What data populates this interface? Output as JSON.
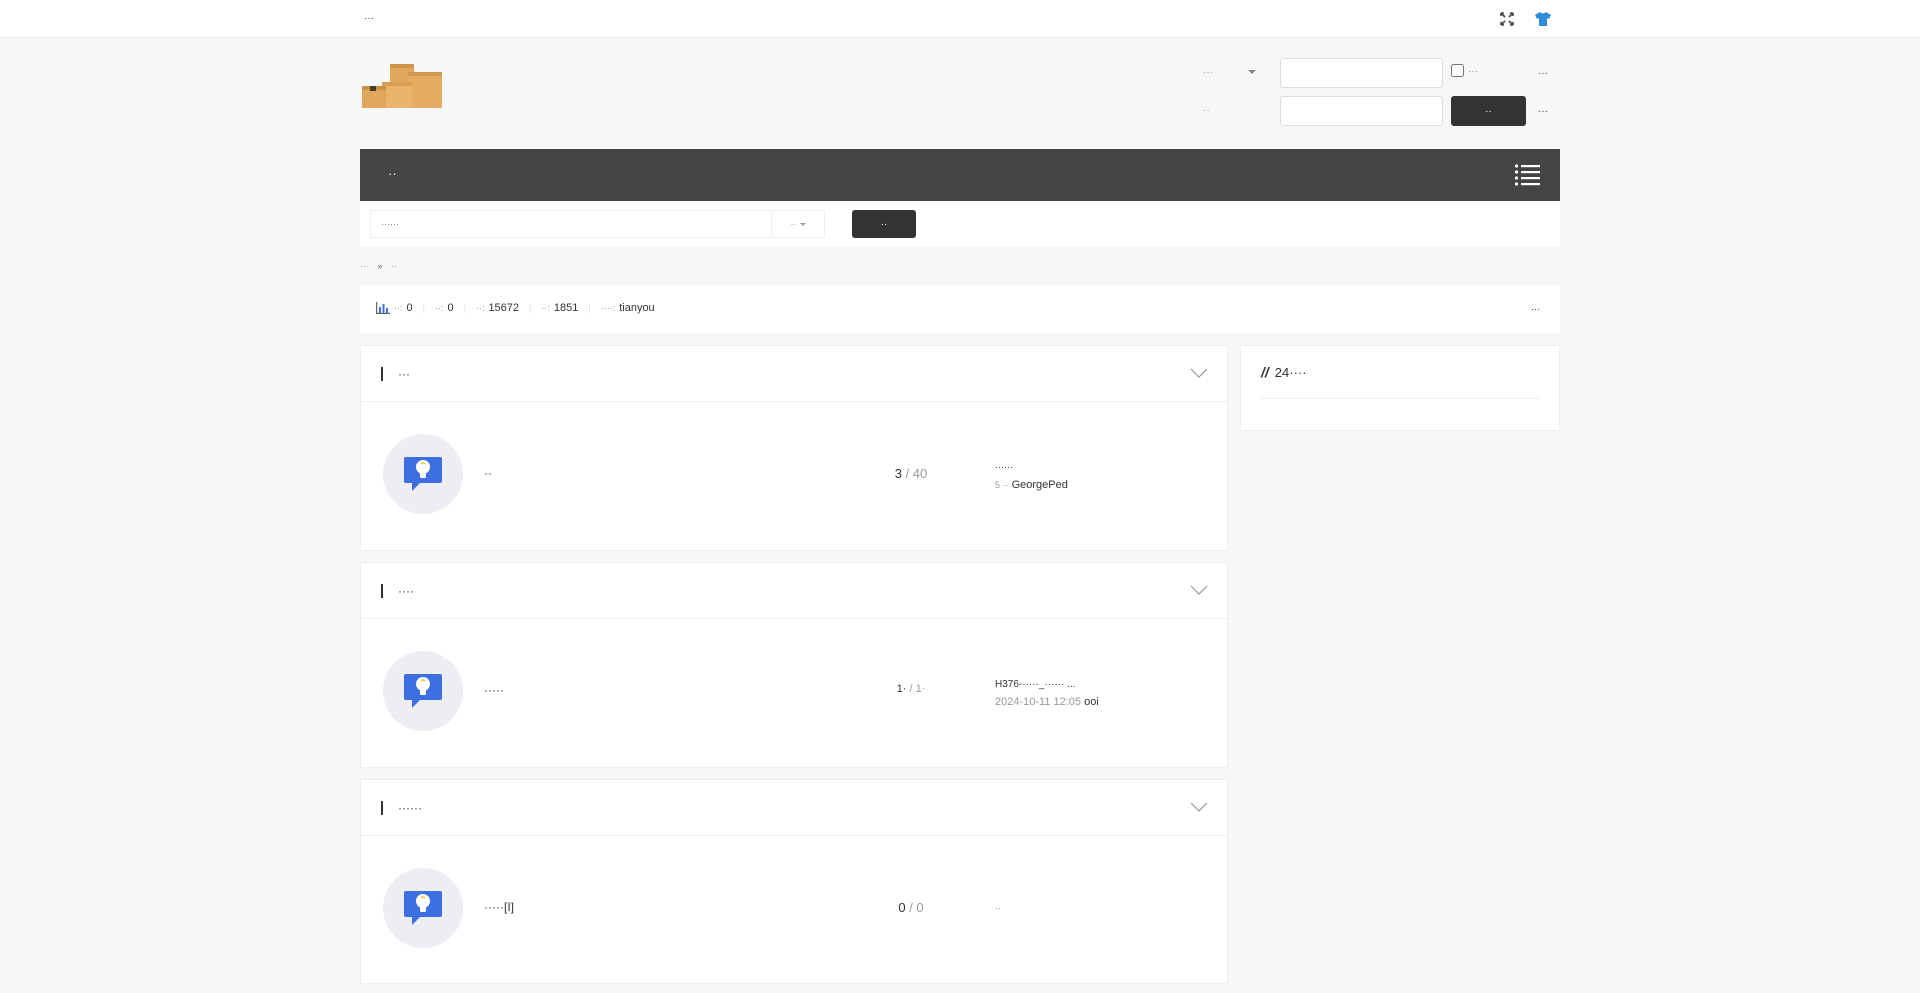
{
  "topbar": {
    "site_label": "···"
  },
  "login": {
    "user_type": "···",
    "password_label": "··",
    "remember_label": "···",
    "auto_link": "···",
    "login_button": "··",
    "register_link": "···"
  },
  "nav": {
    "home": "··"
  },
  "search": {
    "placeholder": "······",
    "type": "··",
    "button": "··"
  },
  "breadcrumb": {
    "home": "···",
    "sep": "»",
    "current": "··"
  },
  "stats": {
    "today_label": "··:",
    "today": "0",
    "yesterday_label": "··:",
    "yesterday": "0",
    "posts_label": "··:",
    "posts": "15672",
    "members_label": "··:",
    "members": "1851",
    "newest_label": "····:",
    "newest": "tianyou",
    "right_link": "···"
  },
  "categories": [
    {
      "title": "···",
      "forum": "··",
      "topics": "3",
      "posts": "40",
      "last_title": "······",
      "last_time": "5 ··",
      "last_user": "GeorgePed"
    },
    {
      "title": "····",
      "forum": "·····",
      "topics": "1·",
      "posts": "1·",
      "last_title": "H376-·····_······ ...",
      "last_time": "2024-10-11 12:05",
      "last_user": "ooi"
    },
    {
      "title": "······",
      "forum": "·····[I]",
      "topics": "0",
      "posts": "0",
      "never": "··"
    }
  ],
  "sidebar": {
    "title": "24····"
  },
  "icons": [
    "fullscreen-icon",
    "theme-shirt-icon",
    "menu-icon",
    "stats-chart-icon",
    "chevron-down-icon",
    "forum-bulb-icon"
  ],
  "colors": {
    "nav_bg": "#444444",
    "button_bg": "#333333",
    "forum_icon_blue": "#3e6fe0",
    "shirt_blue": "#2f8bdc",
    "bulb_yellow": "#f2c94c"
  }
}
